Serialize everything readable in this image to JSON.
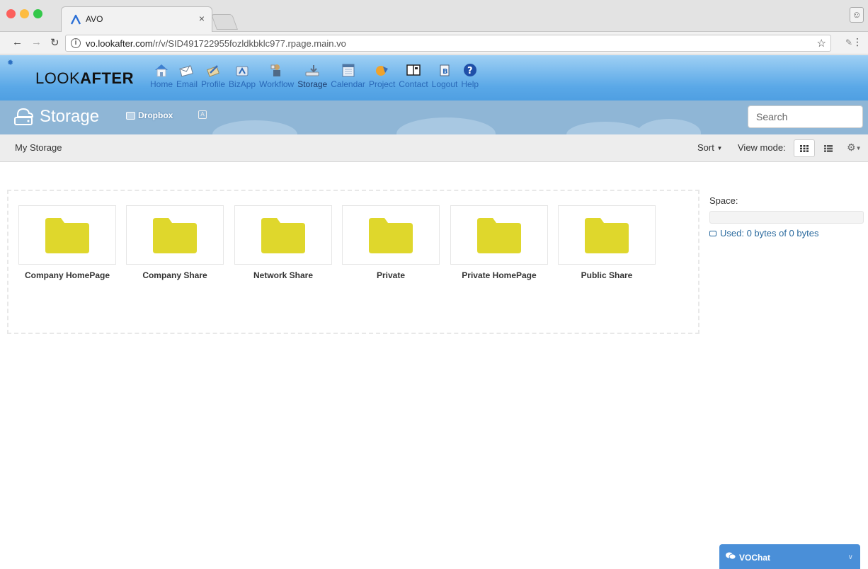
{
  "browser": {
    "tab_title": "AVO",
    "tab_close": "×",
    "url_host": "vo.lookafter.com",
    "url_path": "/r/v/SID491722955fozldkbklc977.rpage.main.vo",
    "colors": {
      "close": "#fc605c",
      "minimize": "#fdbc40",
      "zoom": "#34c84a"
    }
  },
  "app": {
    "logo_light": "LOOK",
    "logo_bold": "AFTER",
    "nav": [
      {
        "label": "Home",
        "icon": "home-icon"
      },
      {
        "label": "Email",
        "icon": "email-icon"
      },
      {
        "label": "Profile",
        "icon": "profile-icon"
      },
      {
        "label": "BizApp",
        "icon": "bizapp-icon"
      },
      {
        "label": "Workflow",
        "icon": "workflow-icon"
      },
      {
        "label": "Storage",
        "icon": "storage-icon"
      },
      {
        "label": "Calendar",
        "icon": "calendar-icon"
      },
      {
        "label": "Project",
        "icon": "project-icon"
      },
      {
        "label": "Contact",
        "icon": "contact-icon"
      },
      {
        "label": "Logout",
        "icon": "logout-icon"
      },
      {
        "label": "Help",
        "icon": "help-icon"
      }
    ],
    "active_nav": "Storage"
  },
  "storage_bar": {
    "title": "Storage",
    "dropbox_label": "Dropbox",
    "search_placeholder": "Search"
  },
  "toolbar": {
    "breadcrumb": "My Storage",
    "sort_label": "Sort",
    "view_mode_label": "View mode:"
  },
  "folders": [
    {
      "name": "Company HomePage"
    },
    {
      "name": "Company Share"
    },
    {
      "name": "Network Share"
    },
    {
      "name": "Private"
    },
    {
      "name": "Private HomePage"
    },
    {
      "name": "Public Share"
    }
  ],
  "space": {
    "label": "Space:",
    "used_text": "Used: 0 bytes of 0 bytes",
    "used_fraction": 0
  },
  "chat": {
    "label": "VOChat"
  },
  "colors": {
    "folder": "#dfd72c",
    "header_blue": "#5aa8e7",
    "nav_link": "#2a69b8",
    "chat_blue": "#4a8fd8"
  }
}
